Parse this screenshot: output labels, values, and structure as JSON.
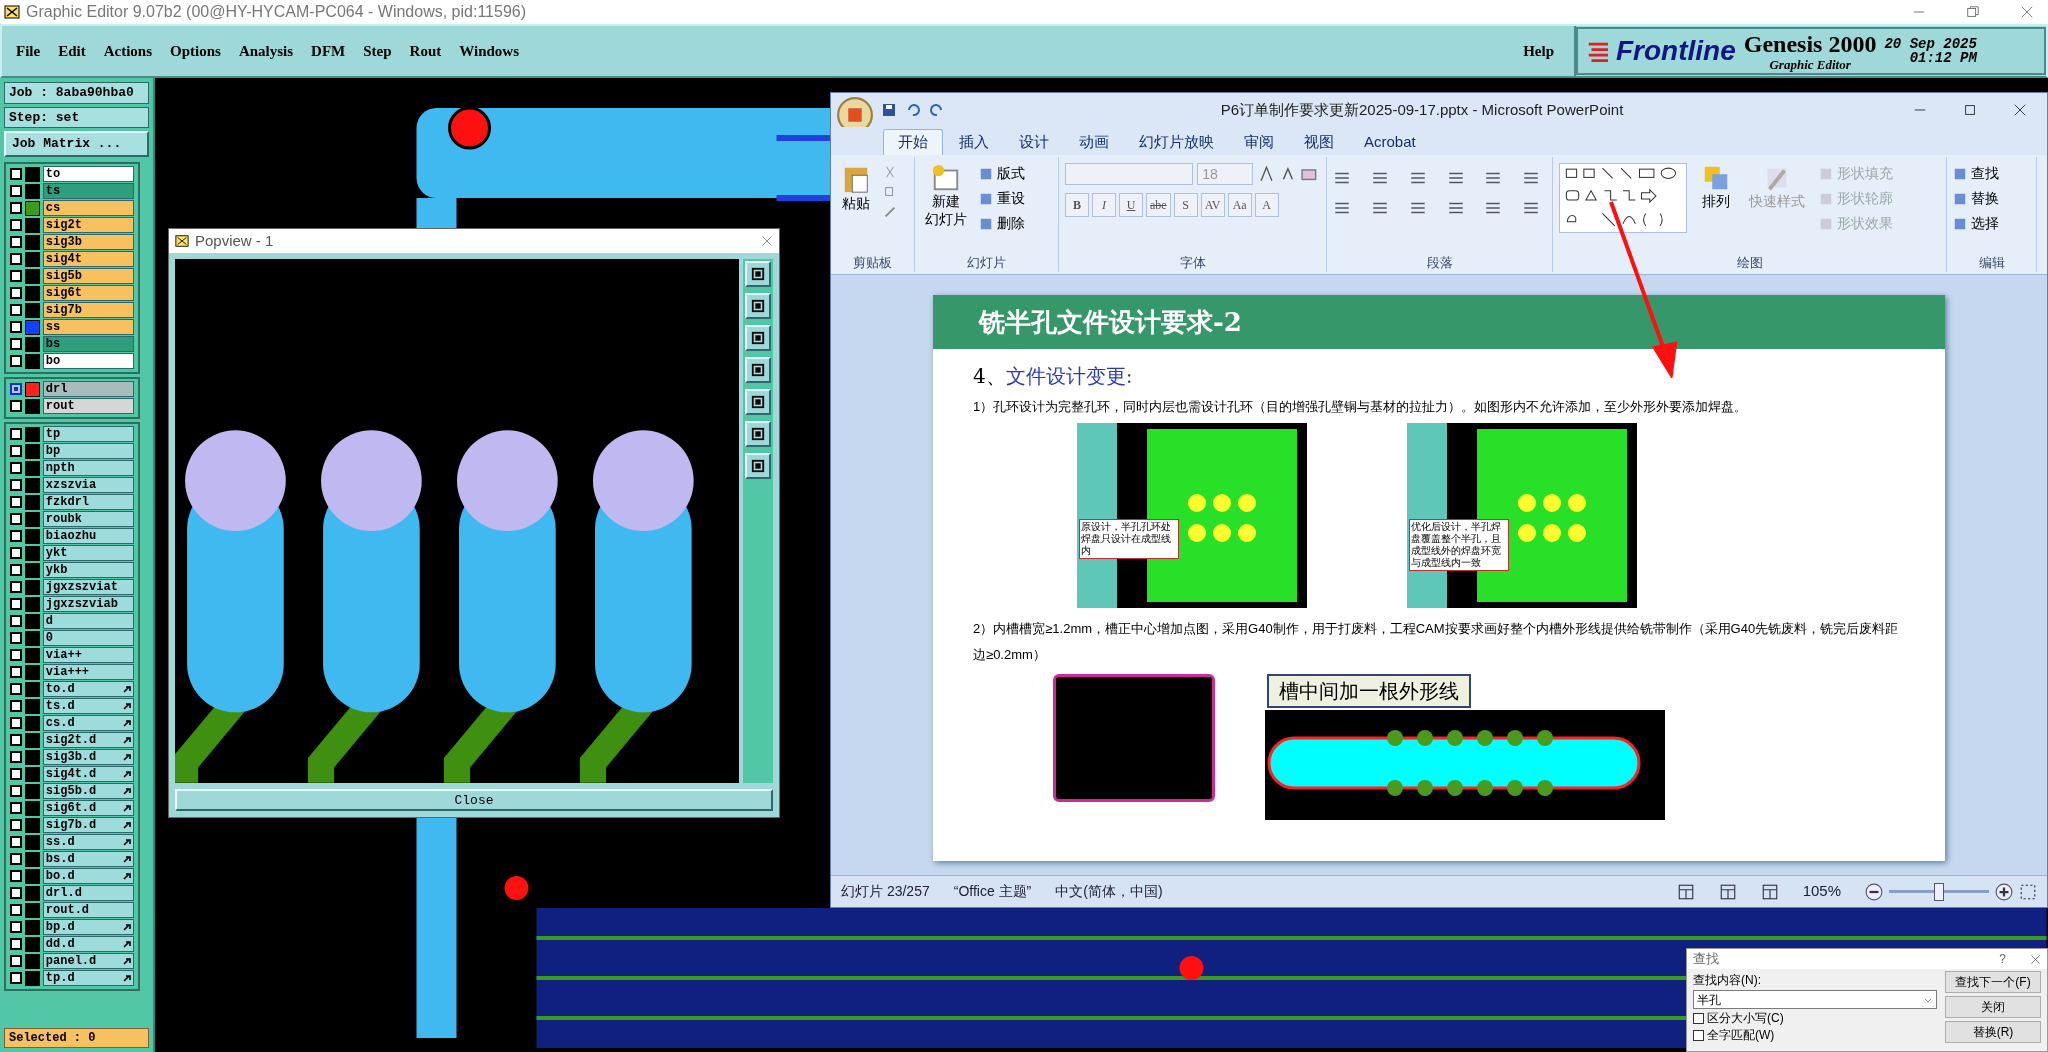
{
  "window": {
    "title": "Graphic Editor 9.07b2 (00@HY-HYCAM-PC064 - Windows, pid:11596)"
  },
  "menu": [
    "File",
    "Edit",
    "Actions",
    "Options",
    "Analysis",
    "DFM",
    "Step",
    "Rout",
    "Windows"
  ],
  "help": "Help",
  "brand": {
    "logo": "Frontline",
    "product": "Genesis 2000",
    "subtitle": "Graphic Editor",
    "date": "20 Sep 2025",
    "time": "01:12 PM"
  },
  "job": "Job : 8aba90hba0",
  "step": "Step: set",
  "job_matrix": "Job Matrix ...",
  "layer_groups": [
    [
      {
        "name": "to",
        "kind": "silk",
        "selected": false,
        "linked": false
      },
      {
        "name": "ts",
        "kind": "mask",
        "selected": false,
        "linked": false
      },
      {
        "name": "cs",
        "kind": "signal",
        "color": "#3f9a1c",
        "selected": false,
        "linked": false
      },
      {
        "name": "sig2t",
        "kind": "signal",
        "selected": false,
        "linked": false
      },
      {
        "name": "sig3b",
        "kind": "signal",
        "selected": false,
        "linked": false
      },
      {
        "name": "sig4t",
        "kind": "signal",
        "selected": false,
        "linked": false
      },
      {
        "name": "sig5b",
        "kind": "signal",
        "selected": false,
        "linked": false
      },
      {
        "name": "sig6t",
        "kind": "signal",
        "selected": false,
        "linked": false
      },
      {
        "name": "sig7b",
        "kind": "signal",
        "selected": false,
        "linked": false
      },
      {
        "name": "ss",
        "kind": "signal",
        "color": "#1440ff",
        "selected": false,
        "linked": false
      },
      {
        "name": "bs",
        "kind": "mask",
        "selected": false,
        "linked": false
      },
      {
        "name": "bo",
        "kind": "silk",
        "selected": false,
        "linked": false
      }
    ],
    [
      {
        "name": "drl",
        "kind": "drill",
        "color": "#ff2020",
        "selected": true,
        "linked": false
      },
      {
        "name": "rout",
        "kind": "rout",
        "selected": false,
        "linked": false
      }
    ],
    [
      {
        "name": "tp",
        "kind": "misc",
        "selected": false,
        "linked": false
      },
      {
        "name": "bp",
        "kind": "misc",
        "selected": false,
        "linked": false
      },
      {
        "name": "npth",
        "kind": "misc",
        "selected": false,
        "linked": false
      },
      {
        "name": "xzszvia",
        "kind": "misc",
        "selected": false,
        "linked": false
      },
      {
        "name": "fzkdrl",
        "kind": "misc",
        "selected": false,
        "linked": false
      },
      {
        "name": "roubk",
        "kind": "misc",
        "selected": false,
        "linked": false
      },
      {
        "name": "biaozhu",
        "kind": "misc",
        "selected": false,
        "linked": false
      },
      {
        "name": "ykt",
        "kind": "misc",
        "selected": false,
        "linked": false
      },
      {
        "name": "ykb",
        "kind": "misc",
        "selected": false,
        "linked": false
      },
      {
        "name": "jgxzszviat",
        "kind": "misc",
        "selected": false,
        "linked": false
      },
      {
        "name": "jgxzszviab",
        "kind": "misc",
        "selected": false,
        "linked": false
      },
      {
        "name": "d",
        "kind": "misc",
        "selected": false,
        "linked": false
      },
      {
        "name": "0",
        "kind": "misc",
        "selected": false,
        "linked": false
      },
      {
        "name": "via++",
        "kind": "misc",
        "selected": false,
        "linked": false
      },
      {
        "name": "via+++",
        "kind": "misc",
        "selected": false,
        "linked": false
      },
      {
        "name": "to.d",
        "kind": "misc",
        "selected": false,
        "linked": true
      },
      {
        "name": "ts.d",
        "kind": "misc",
        "selected": false,
        "linked": true
      },
      {
        "name": "cs.d",
        "kind": "misc",
        "selected": false,
        "linked": true
      },
      {
        "name": "sig2t.d",
        "kind": "misc",
        "selected": false,
        "linked": true
      },
      {
        "name": "sig3b.d",
        "kind": "misc",
        "selected": false,
        "linked": true
      },
      {
        "name": "sig4t.d",
        "kind": "misc",
        "selected": false,
        "linked": true
      },
      {
        "name": "sig5b.d",
        "kind": "misc",
        "selected": false,
        "linked": true
      },
      {
        "name": "sig6t.d",
        "kind": "misc",
        "selected": false,
        "linked": true
      },
      {
        "name": "sig7b.d",
        "kind": "misc",
        "selected": false,
        "linked": true
      },
      {
        "name": "ss.d",
        "kind": "misc",
        "selected": false,
        "linked": true
      },
      {
        "name": "bs.d",
        "kind": "misc",
        "selected": false,
        "linked": true
      },
      {
        "name": "bo.d",
        "kind": "misc",
        "selected": false,
        "linked": true
      },
      {
        "name": "drl.d",
        "kind": "misc",
        "selected": false,
        "linked": false
      },
      {
        "name": "rout.d",
        "kind": "misc",
        "selected": false,
        "linked": false
      },
      {
        "name": "bp.d",
        "kind": "misc",
        "selected": false,
        "linked": true
      },
      {
        "name": "dd.d",
        "kind": "misc",
        "selected": false,
        "linked": true
      },
      {
        "name": "panel.d",
        "kind": "misc",
        "selected": false,
        "linked": true
      },
      {
        "name": "tp.d",
        "kind": "misc",
        "selected": false,
        "linked": true
      }
    ]
  ],
  "selected_count": "Selected : 0",
  "popview": {
    "title": "Popview - 1",
    "close": "Close"
  },
  "powerpoint": {
    "title": "P6订单制作要求更新2025-09-17.pptx - Microsoft PowerPoint",
    "tabs": [
      {
        "label": "开始",
        "selected": true
      },
      {
        "label": "插入",
        "selected": false
      },
      {
        "label": "设计",
        "selected": false
      },
      {
        "label": "动画",
        "selected": false
      },
      {
        "label": "幻灯片放映",
        "selected": false
      },
      {
        "label": "审阅",
        "selected": false
      },
      {
        "label": "视图",
        "selected": false
      },
      {
        "label": "Acrobat",
        "selected": false
      }
    ],
    "groups": [
      {
        "kind": "clipboard",
        "title": "剪贴板",
        "big": "粘贴"
      },
      {
        "kind": "slides",
        "title": "幻灯片",
        "big": "新建",
        "big2": "幻灯片",
        "small": [
          {
            "label": "版式",
            "disabled": false
          },
          {
            "label": "重设",
            "disabled": false
          },
          {
            "label": "删除",
            "disabled": false
          }
        ]
      },
      {
        "kind": "font",
        "title": "字体",
        "size": "18",
        "buttons": [
          "B",
          "I",
          "U",
          "abe",
          "S",
          "AV",
          "Aa",
          "A"
        ]
      },
      {
        "kind": "paragraph",
        "title": "段落"
      },
      {
        "kind": "drawing",
        "title": "绘图",
        "big": "排列",
        "big2": "快速样式",
        "small": [
          {
            "label": "形状填充",
            "disabled": true
          },
          {
            "label": "形状轮廓",
            "disabled": true
          },
          {
            "label": "形状效果",
            "disabled": true
          }
        ]
      },
      {
        "kind": "editing",
        "title": "编辑",
        "small": [
          {
            "label": "查找",
            "disabled": false
          },
          {
            "label": "替换",
            "disabled": false
          },
          {
            "label": "选择",
            "disabled": false
          }
        ]
      }
    ],
    "slide": {
      "title": "铣半孔文件设计要求-2",
      "number": "4、",
      "heading": "文件设计变更:",
      "para1": "1）孔环设计为完整孔环，同时内层也需设计孔环（目的增强孔壁铜与基材的拉扯力）。如图形内不允许添加，至少外形外要添加焊盘。",
      "caption1": "原设计，半孔孔环处焊盘只设计在成型线内",
      "caption2": "优化后设计，半孔焊盘覆盖整个半孔，且成型线外的焊盘环宽与成型线内一致",
      "para2": "2）内槽槽宽≥1.2mm，槽正中心增加点图，采用G40制作，用于打废料，工程CAM按要求画好整个内槽外形线提供给铣带制作（采用G40先铣废料，铣完后废料距边≥0.2mm）",
      "callout": "槽中间加一根外形线"
    },
    "status": [
      "幻灯片 23/257",
      "“Office 主题”",
      "中文(简体，中国)"
    ],
    "zoom": {
      "reading": "105%",
      "level": 0.5
    }
  },
  "find": {
    "title": "查找",
    "help": "?",
    "label": "查找内容(N):",
    "value": "半孔",
    "options": [
      {
        "label": "区分大小写(C)",
        "checked": false
      },
      {
        "label": "全字匹配(W)",
        "checked": false
      }
    ],
    "buttons": [
      "查找下一个(F)",
      "关闭",
      "替换(R)"
    ]
  }
}
